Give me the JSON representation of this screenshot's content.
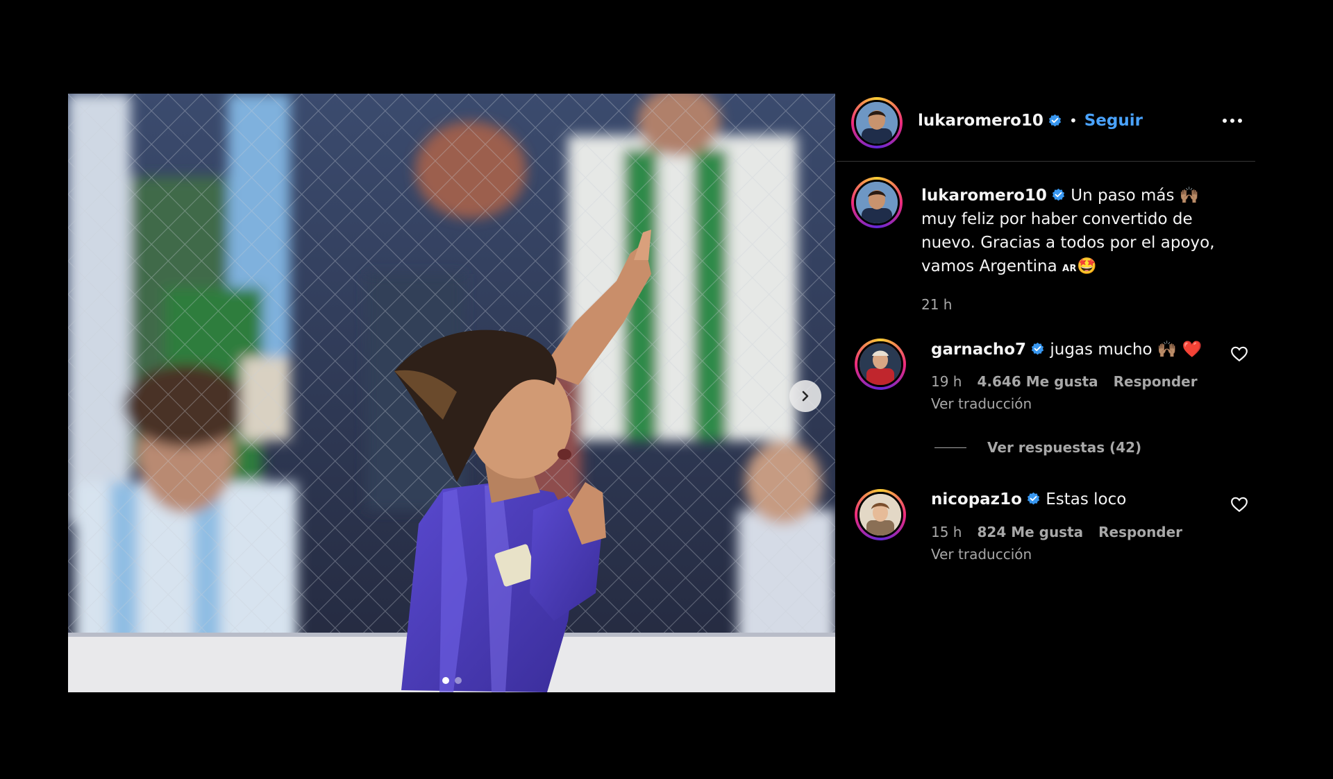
{
  "post": {
    "image_alt": "Futbolista con camiseta violeta celebrando un gol",
    "carousel": {
      "slides": 2,
      "current": 1
    }
  },
  "header": {
    "username": "lukaromero10",
    "separator": "•",
    "follow_label": "Seguir",
    "more_icon": "more-horizontal-icon"
  },
  "caption": {
    "username": "lukaromero10",
    "text": "Un paso más 🙌🏽 muy feliz por haber convertido de nuevo. Gracias a todos por el apoyo, vamos Argentina",
    "flag": "AR",
    "emoji_end": "🤩",
    "time": "21 h"
  },
  "comments": [
    {
      "username": "garnacho7",
      "text": "jugas mucho 🙌🏽 ❤️",
      "time": "19 h",
      "likes": "4.646 Me gusta",
      "reply_label": "Responder",
      "translate_label": "Ver traducción"
    },
    {
      "username": "nicopaz1o",
      "text": "Estas loco",
      "time": "15 h",
      "likes": "824 Me gusta",
      "reply_label": "Responder",
      "translate_label": "Ver traducción"
    }
  ],
  "replies": {
    "label": "Ver respuestas (42)"
  },
  "colors": {
    "link": "#4aa3ff",
    "verified": "#3897f0",
    "muted": "#a8a8a8",
    "jersey": "#4a3bb5"
  }
}
